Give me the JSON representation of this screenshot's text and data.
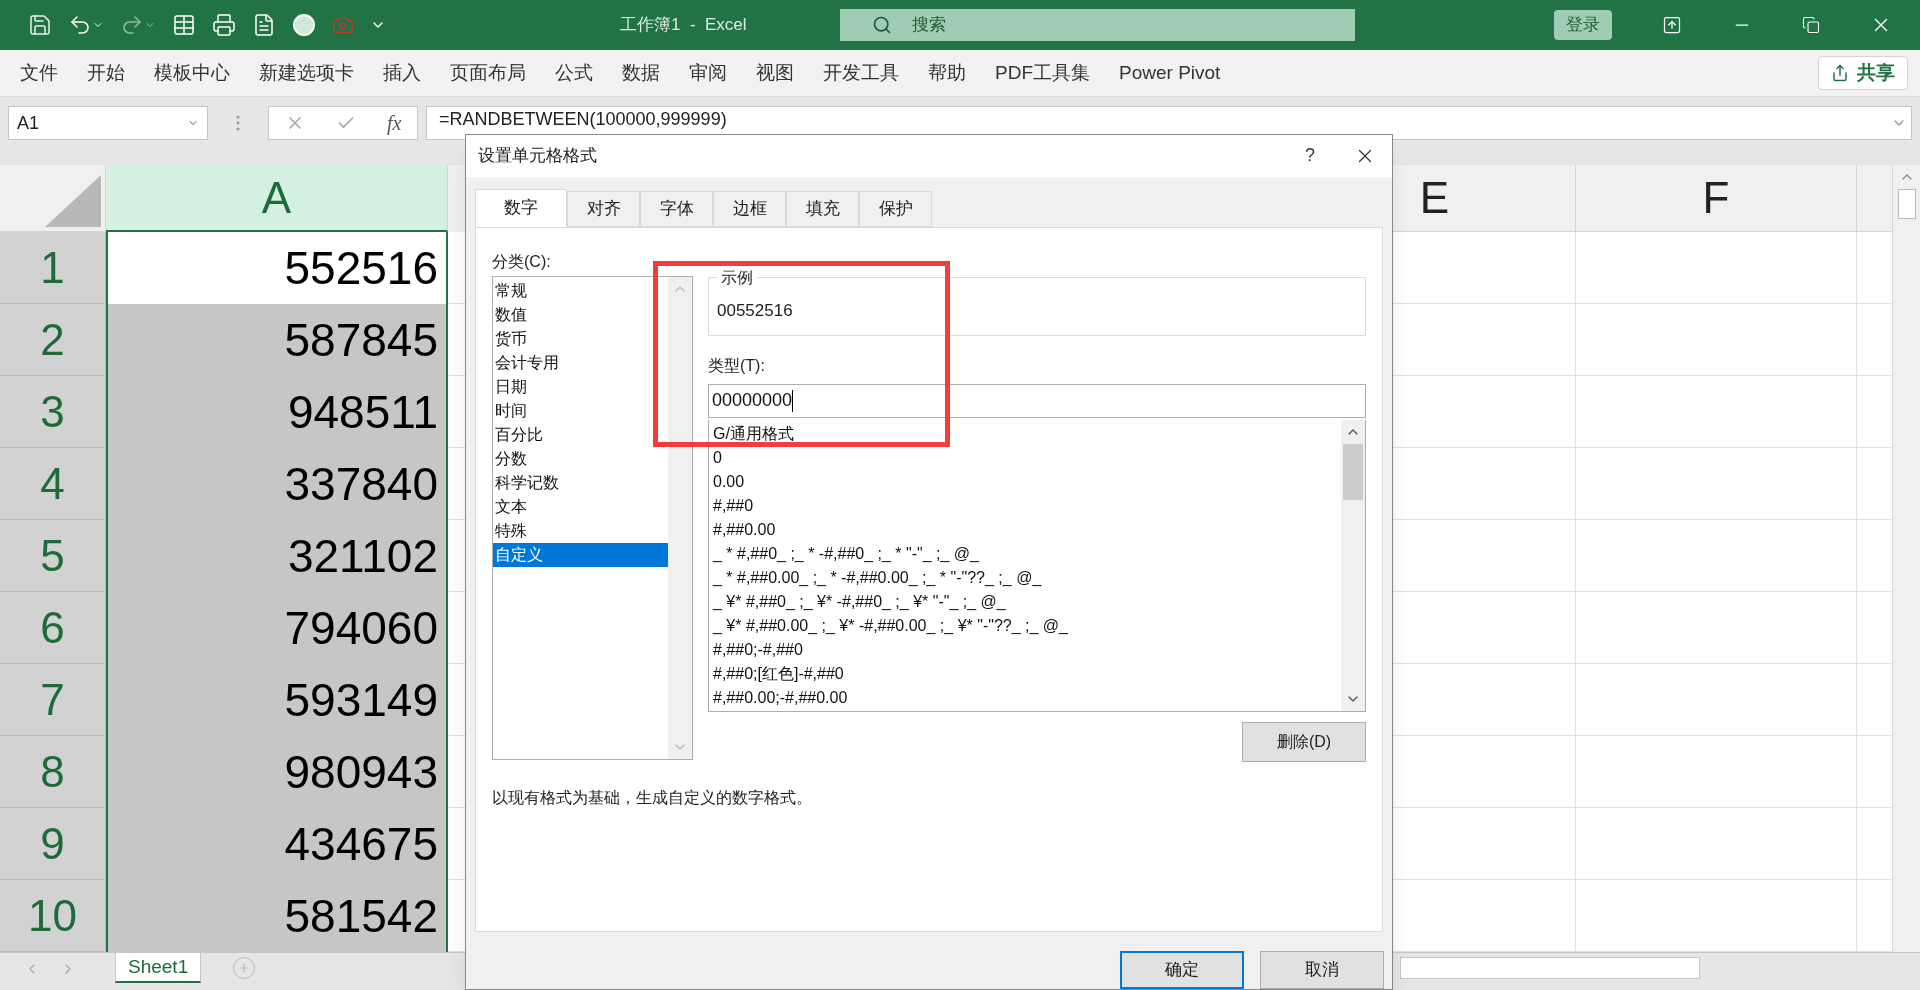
{
  "title_bar": {
    "title": "工作簿1  -  Excel",
    "search": {
      "placeholder": "搜索"
    },
    "login_button": "登录"
  },
  "ribbon_tabs": [
    "文件",
    "开始",
    "模板中心",
    "新建选项卡",
    "插入",
    "页面布局",
    "公式",
    "数据",
    "审阅",
    "视图",
    "开发工具",
    "帮助",
    "PDF工具集",
    "Power Pivot"
  ],
  "share_button": "共享",
  "formula_bar": {
    "name_box": "A1",
    "function_label": "fx",
    "formula": "=RANDBETWEEN(100000,999999)"
  },
  "sheet": {
    "columns": [
      {
        "label": "A",
        "selected": true
      },
      {
        "label": "E",
        "selected": false
      },
      {
        "label": "F",
        "selected": false
      }
    ],
    "rows": [
      {
        "number": "1",
        "value": "552516",
        "selected": true,
        "active": true
      },
      {
        "number": "2",
        "value": "587845",
        "selected": true,
        "active": false
      },
      {
        "number": "3",
        "value": "948511",
        "selected": true,
        "active": false
      },
      {
        "number": "4",
        "value": "337840",
        "selected": true,
        "active": false
      },
      {
        "number": "5",
        "value": "321102",
        "selected": true,
        "active": false
      },
      {
        "number": "6",
        "value": "794060",
        "selected": true,
        "active": false
      },
      {
        "number": "7",
        "value": "593149",
        "selected": true,
        "active": false
      },
      {
        "number": "8",
        "value": "980943",
        "selected": true,
        "active": false
      },
      {
        "number": "9",
        "value": "434675",
        "selected": true,
        "active": false
      },
      {
        "number": "10",
        "value": "581542",
        "selected": true,
        "active": false
      }
    ]
  },
  "sheet_tabs": [
    {
      "label": "Sheet1",
      "selected": true
    }
  ],
  "dialog": {
    "title": "设置单元格格式",
    "help": "?",
    "tabs": [
      {
        "label": "数字",
        "selected": true
      },
      {
        "label": "对齐",
        "selected": false
      },
      {
        "label": "字体",
        "selected": false
      },
      {
        "label": "边框",
        "selected": false
      },
      {
        "label": "填充",
        "selected": false
      },
      {
        "label": "保护",
        "selected": false
      }
    ],
    "category_label": "分类(C):",
    "categories": [
      {
        "label": "常规",
        "selected": false
      },
      {
        "label": "数值",
        "selected": false
      },
      {
        "label": "货币",
        "selected": false
      },
      {
        "label": "会计专用",
        "selected": false
      },
      {
        "label": "日期",
        "selected": false
      },
      {
        "label": "时间",
        "selected": false
      },
      {
        "label": "百分比",
        "selected": false
      },
      {
        "label": "分数",
        "selected": false
      },
      {
        "label": "科学记数",
        "selected": false
      },
      {
        "label": "文本",
        "selected": false
      },
      {
        "label": "特殊",
        "selected": false
      },
      {
        "label": "自定义",
        "selected": true
      }
    ],
    "sample_label": "示例",
    "sample_value": "00552516",
    "type_label": "类型(T):",
    "type_value": "00000000",
    "formats": [
      "G/通用格式",
      "0",
      "0.00",
      "#,##0",
      "#,##0.00",
      "_ * #,##0_ ;_ * -#,##0_ ;_ * \"-\"_ ;_ @_",
      "_ * #,##0.00_ ;_ * -#,##0.00_ ;_ * \"-\"??_ ;_ @_",
      "_ ¥* #,##0_ ;_ ¥* -#,##0_ ;_ ¥* \"-\"_ ;_ @_",
      "_ ¥* #,##0.00_ ;_ ¥* -#,##0.00_ ;_ ¥* \"-\"??_ ;_ @_",
      "#,##0;-#,##0",
      "#,##0;[红色]-#,##0",
      "#,##0.00;-#,##0.00"
    ],
    "delete_button": "删除(D)",
    "description": "以现有格式为基础，生成自定义的数字格式。",
    "ok_button": "确定",
    "cancel_button": "取消"
  },
  "annotation": {
    "color": "#f23d3d"
  }
}
